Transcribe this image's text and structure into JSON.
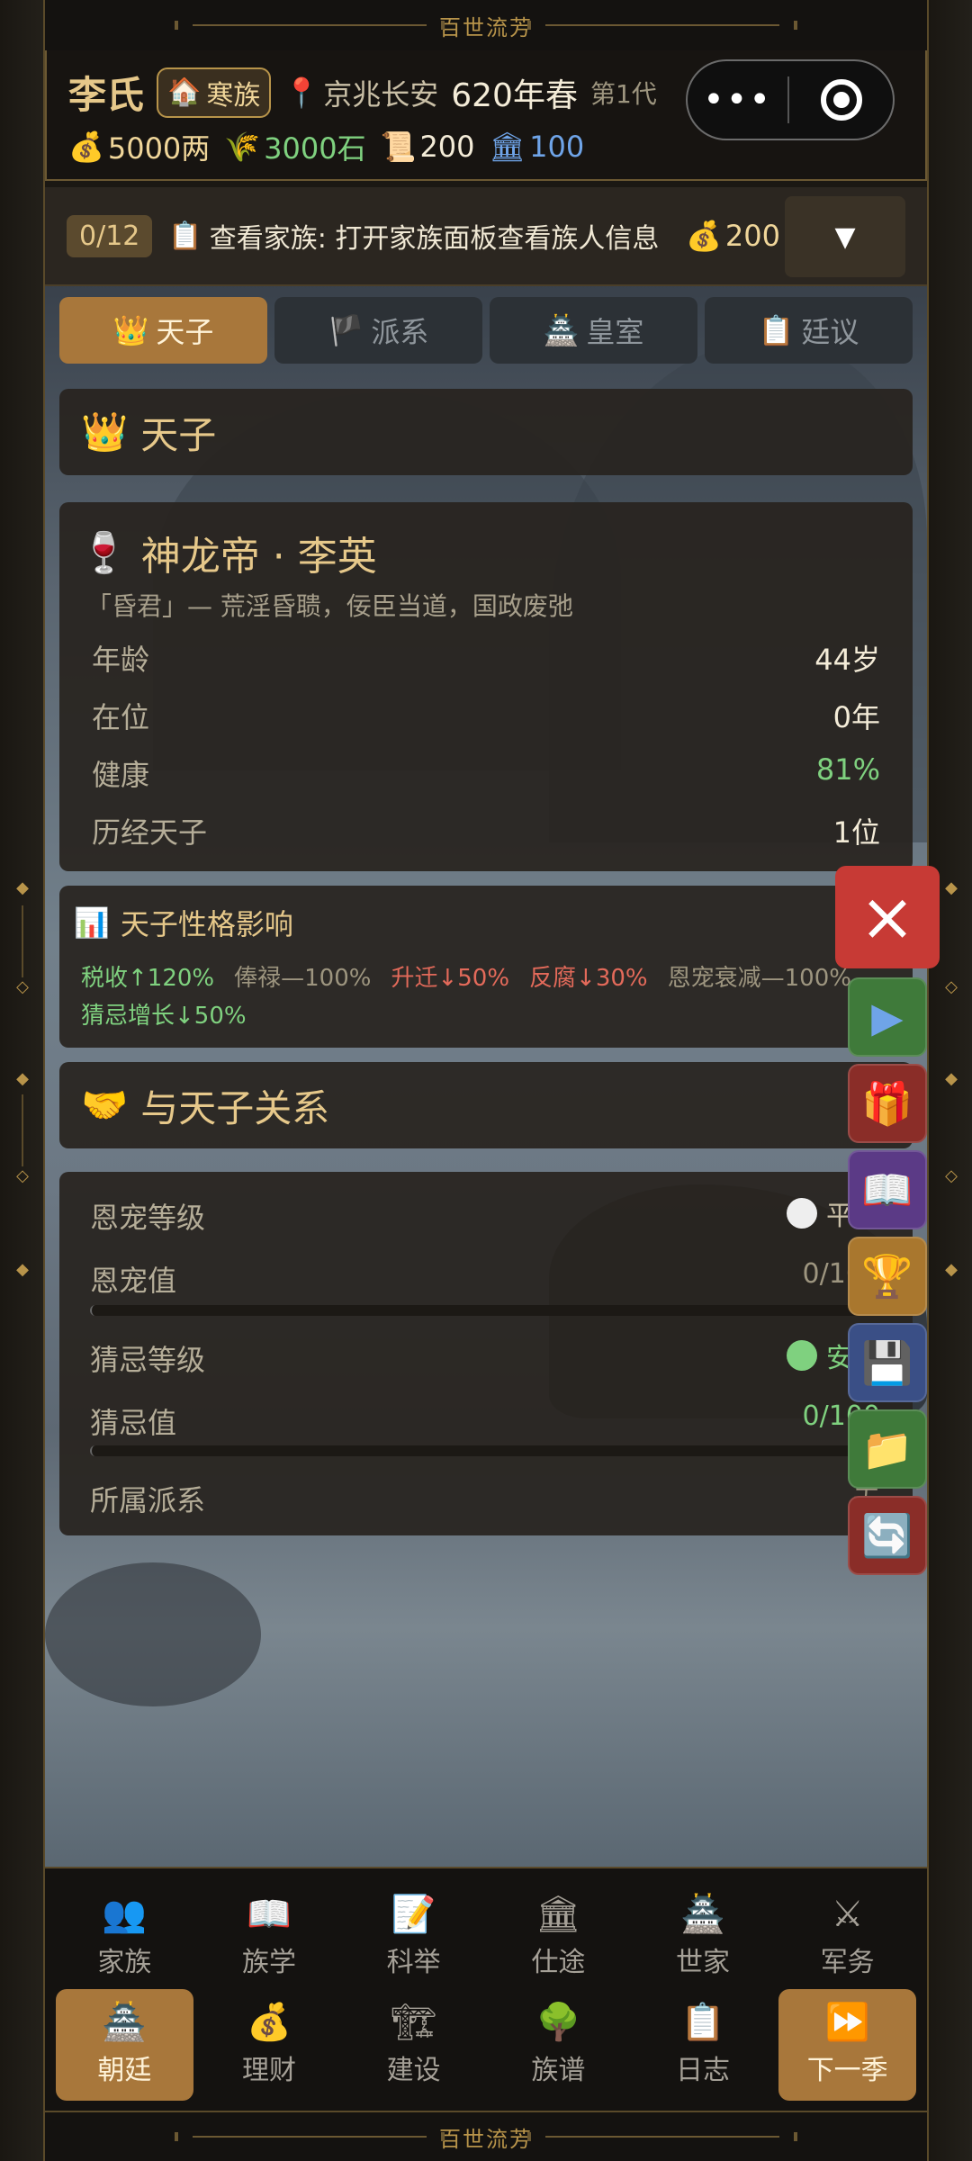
{
  "banner": {
    "text": "百世流芳"
  },
  "header": {
    "family_name": "李氏",
    "rank": "寒族",
    "place": "京兆长安",
    "year": "620年春",
    "generation": "第1代",
    "resources": {
      "money": "5000两",
      "grain": "3000石",
      "scrolls": "200",
      "power": "100"
    }
  },
  "quest": {
    "count": "0/12",
    "text": "查看家族: 打开家族面板查看族人信息",
    "reward": "200",
    "toggle": "▼"
  },
  "tabs": [
    {
      "label": "天子",
      "icon": "crown-icon"
    },
    {
      "label": "派系",
      "icon": "flag-icon"
    },
    {
      "label": "皇室",
      "icon": "palace-icon"
    },
    {
      "label": "廷议",
      "icon": "clipboard-icon"
    }
  ],
  "section_emperor": {
    "title": "天子"
  },
  "emperor": {
    "name": "神龙帝 · 李英",
    "desc": "「昏君」— 荒淫昏聩，佞臣当道，国政废弛",
    "rows": [
      {
        "label": "年龄",
        "value": "44岁"
      },
      {
        "label": "在位",
        "value": "0年"
      },
      {
        "label": "健康",
        "value": "81%"
      },
      {
        "label": "历经天子",
        "value": "1位"
      }
    ]
  },
  "traits": {
    "title": "天子性格影响",
    "line1": [
      {
        "text": "税收↑120%",
        "tone": "green"
      },
      {
        "text": "俸禄—100%",
        "tone": "gray"
      },
      {
        "text": "升迁↓50%",
        "tone": "red"
      },
      {
        "text": "反腐↓30%",
        "tone": "red"
      },
      {
        "text": "恩宠衰减—100%",
        "tone": "gray"
      }
    ],
    "line2": [
      {
        "text": "猜忌增长↓50%",
        "tone": "green"
      }
    ]
  },
  "section_relation": {
    "title": "与天子关系"
  },
  "relation": {
    "favor_level_label": "恩宠等级",
    "favor_level_value": "平常",
    "favor_value_label": "恩宠值",
    "favor_value": "0/100",
    "favor_fraction": 0,
    "suspicion_level_label": "猜忌等级",
    "suspicion_level_value": "安稳",
    "suspicion_value_label": "猜忌值",
    "suspicion_value": "0/100",
    "suspicion_fraction": 0,
    "faction_label": "所属派系",
    "faction_value": "无"
  },
  "floating": {
    "close": "×",
    "buttons": [
      {
        "name": "play-icon",
        "glyph": "▶",
        "color": "#3f7a3a"
      },
      {
        "name": "gift-icon",
        "glyph": "🎁",
        "color": "#8a2d28"
      },
      {
        "name": "book-icon",
        "glyph": "📖",
        "color": "#5b3a86"
      },
      {
        "name": "trophy-icon",
        "glyph": "🏆",
        "color": "#a9772e"
      },
      {
        "name": "save-icon",
        "glyph": "💾",
        "color": "#3a4f86"
      },
      {
        "name": "folder-icon",
        "glyph": "📁",
        "color": "#3f7a3a"
      },
      {
        "name": "refresh-icon",
        "glyph": "🔄",
        "color": "#8a2d28"
      }
    ]
  },
  "nav": {
    "row1": [
      {
        "label": "家族",
        "icon": "👥",
        "name": "family"
      },
      {
        "label": "族学",
        "icon": "📖",
        "name": "clan-school"
      },
      {
        "label": "科举",
        "icon": "📝",
        "name": "exam"
      },
      {
        "label": "仕途",
        "icon": "🏛",
        "name": "career"
      },
      {
        "label": "世家",
        "icon": "🏯",
        "name": "noble-houses"
      },
      {
        "label": "军务",
        "icon": "⚔",
        "name": "military"
      }
    ],
    "row2": [
      {
        "label": "朝廷",
        "icon": "🏯",
        "name": "court"
      },
      {
        "label": "理财",
        "icon": "💰",
        "name": "finance"
      },
      {
        "label": "建设",
        "icon": "🏗",
        "name": "build"
      },
      {
        "label": "族谱",
        "icon": "🌳",
        "name": "genealogy"
      },
      {
        "label": "日志",
        "icon": "📋",
        "name": "log"
      },
      {
        "label": "下一季",
        "icon": "⏩",
        "name": "next-season"
      }
    ]
  },
  "colors": {
    "accent": "#a8773b",
    "gold": "#e6c88a",
    "positive": "#7fd17f",
    "negative": "#e36a5a"
  }
}
